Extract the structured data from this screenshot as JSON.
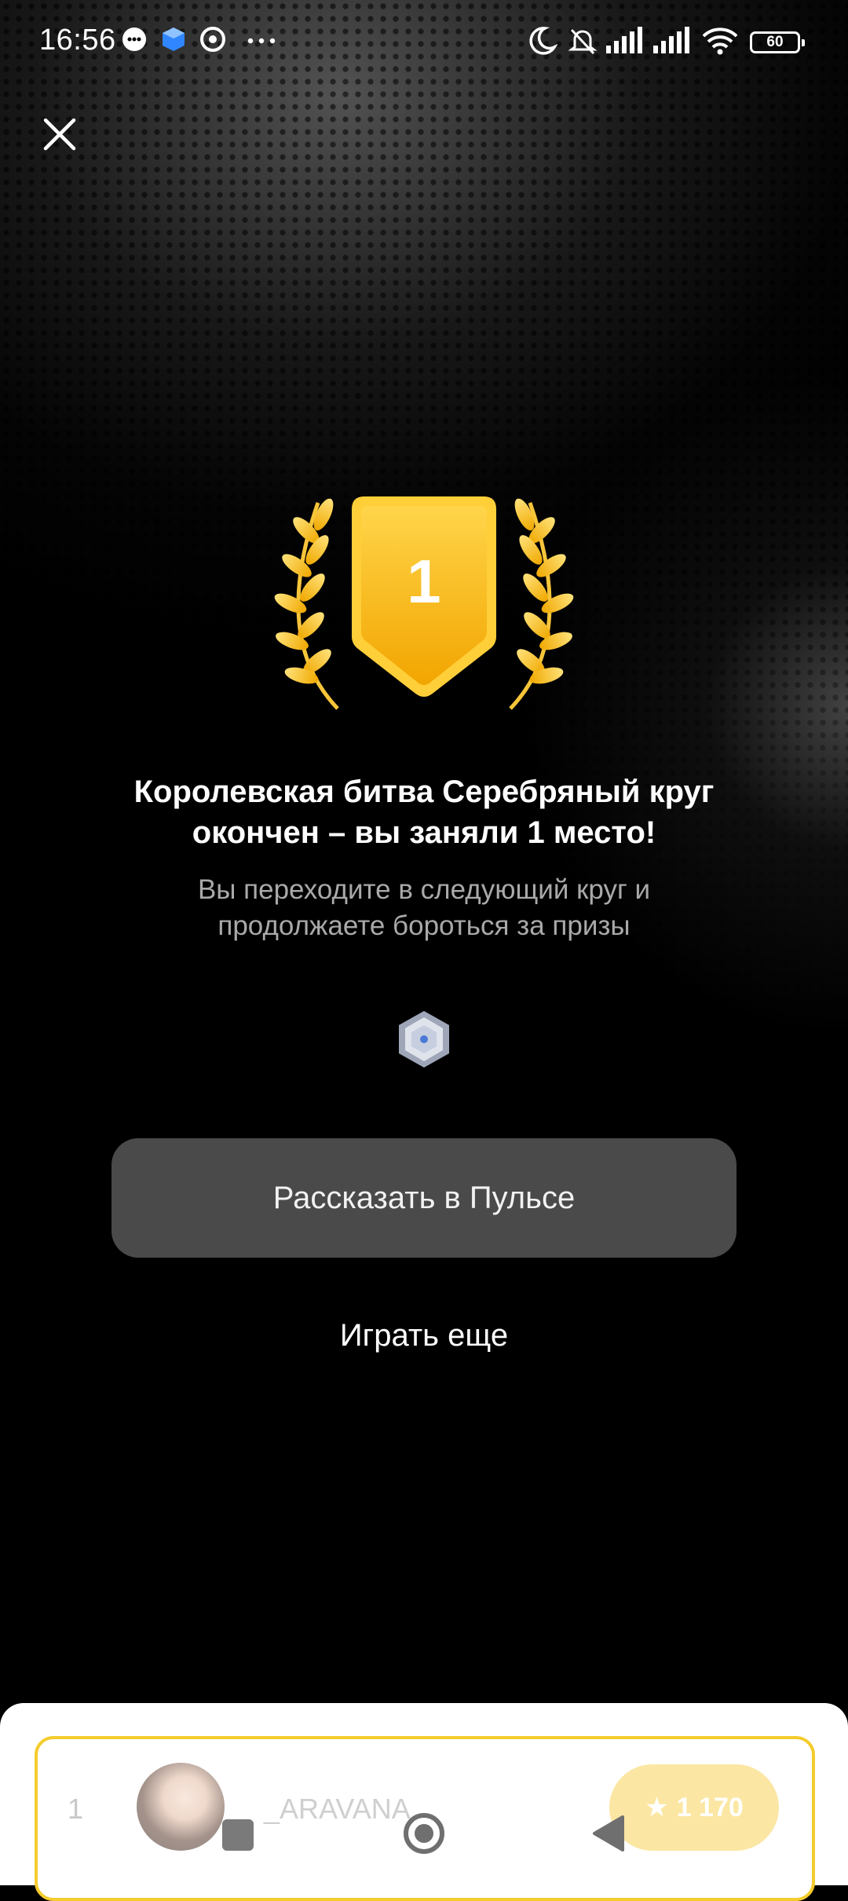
{
  "status_bar": {
    "time": "16:56",
    "icons": [
      "messenger-icon",
      "cube-app-icon",
      "chrome-icon",
      "more-dots-icon",
      "do-not-disturb-moon-icon",
      "muted-bell-icon",
      "signal-icon",
      "signal-icon",
      "wifi-icon",
      "battery-icon"
    ],
    "battery": "60"
  },
  "header": {
    "close_icon": "close-icon"
  },
  "badge": {
    "place_number": "1",
    "colors": {
      "gold_light": "#ffcf3a",
      "gold_dark": "#f2a500"
    }
  },
  "result": {
    "title_line1": "Королевская битва Серебряный круг",
    "title_line2": "окончен – вы заняли 1 место!",
    "subtitle_line1": "Вы переходите в следующий круг и",
    "subtitle_line2": "продолжаете бороться за призы"
  },
  "actions": {
    "share_label": "Рассказать в Пульсе",
    "play_again_label": "Играть еще"
  },
  "leaderboard": {
    "row": {
      "position": "1",
      "username": "_ARAVANA",
      "points": "1 170"
    }
  },
  "colors": {
    "accent": "#f5cc2e",
    "button_bg": "#4a4a4a",
    "subtitle": "#a9a9a9"
  }
}
